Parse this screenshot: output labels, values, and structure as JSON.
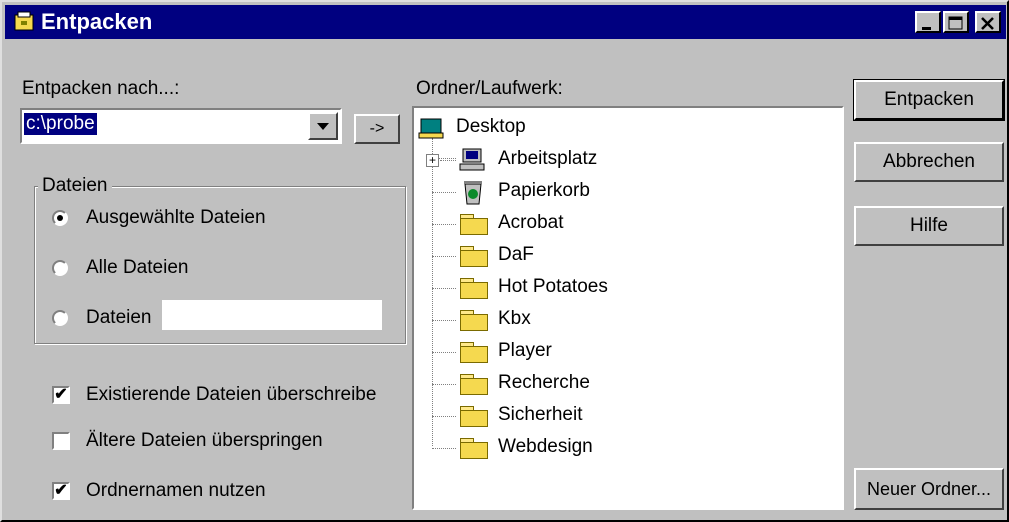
{
  "window": {
    "title": "Entpacken"
  },
  "left": {
    "dest_label": "Entpacken nach...:",
    "dest_value": "c:\\probe",
    "arrow_button": "->",
    "group_title": "Dateien",
    "radios": [
      {
        "label": "Ausgewählte Dateien",
        "selected": true
      },
      {
        "label": "Alle Dateien",
        "selected": false
      },
      {
        "label": "Dateien",
        "selected": false
      }
    ],
    "checks": [
      {
        "label": "Existierende Dateien überschreibe",
        "checked": true
      },
      {
        "label": "Ältere Dateien überspringen",
        "checked": false
      },
      {
        "label": "Ordnernamen nutzen",
        "checked": true
      }
    ]
  },
  "tree": {
    "label": "Ordner/Laufwerk:",
    "root": "Desktop",
    "items": [
      {
        "label": "Arbeitsplatz",
        "icon": "computer-icon",
        "expandable": true
      },
      {
        "label": "Papierkorb",
        "icon": "recycle-bin-icon"
      },
      {
        "label": "Acrobat",
        "icon": "folder-icon"
      },
      {
        "label": "DaF",
        "icon": "folder-icon"
      },
      {
        "label": "Hot Potatoes",
        "icon": "folder-icon"
      },
      {
        "label": "Kbx",
        "icon": "folder-icon"
      },
      {
        "label": "Player",
        "icon": "folder-icon"
      },
      {
        "label": "Recherche",
        "icon": "folder-icon"
      },
      {
        "label": "Sicherheit",
        "icon": "folder-icon"
      },
      {
        "label": "Webdesign",
        "icon": "folder-icon"
      }
    ]
  },
  "buttons": {
    "extract": "Entpacken",
    "cancel": "Abbrechen",
    "help": "Hilfe",
    "new_folder": "Neuer Ordner..."
  },
  "colors": {
    "titlebar": "#000080",
    "face": "#c0c0c0",
    "folder": "#f5d94f"
  }
}
